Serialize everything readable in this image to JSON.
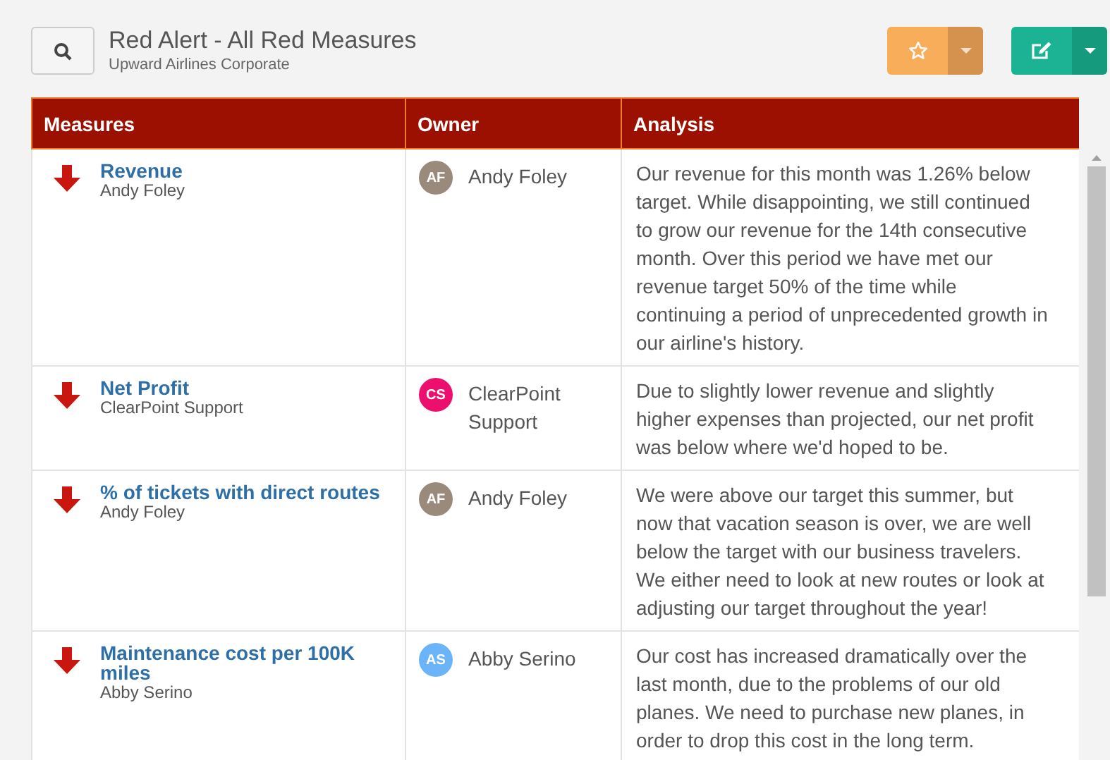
{
  "header": {
    "title": "Red Alert - All Red Measures",
    "subtitle": "Upward Airlines Corporate"
  },
  "table": {
    "columns": [
      "Measures",
      "Owner",
      "Analysis"
    ],
    "rows": [
      {
        "measure": "Revenue",
        "measure_owner": "Andy Foley",
        "kind": "down",
        "owner": {
          "initials": "AF",
          "name": "Andy Foley",
          "color": "#9a8a7c"
        },
        "analysis": "Our revenue for this month was 1.26% below target. While disappointing, we still continued to grow our revenue for the 14th consecutive month. Over this period we have met our revenue target 50% of the time while continuing a period of unprecedented growth in our airline's history."
      },
      {
        "measure": "Net Profit",
        "measure_owner": "ClearPoint Support",
        "kind": "down",
        "owner": {
          "initials": "CS",
          "name": "ClearPoint Support",
          "color": "#ec0f6e"
        },
        "analysis": "Due to slightly lower revenue and slightly higher expenses than projected, our net profit was below where we'd hoped to be."
      },
      {
        "measure": "% of tickets with direct routes",
        "measure_owner": "Andy Foley",
        "kind": "down",
        "owner": {
          "initials": "AF",
          "name": "Andy Foley",
          "color": "#9a8a7c"
        },
        "analysis": "We were above our target this summer, but now that vacation season is over, we are well below the target with our business travelers.  We either need to look at new routes or look at adjusting our target throughout the year!"
      },
      {
        "measure": "Maintenance cost per 100K miles",
        "measure_owner": "Abby Serino",
        "kind": "down",
        "owner": {
          "initials": "AS",
          "name": "Abby Serino",
          "color": "#6ab4f7"
        },
        "analysis": "Our cost has increased dramatically over the last month, due to the problems of our old planes. We need to purchase new planes, in order to drop this cost in the long term."
      }
    ]
  }
}
